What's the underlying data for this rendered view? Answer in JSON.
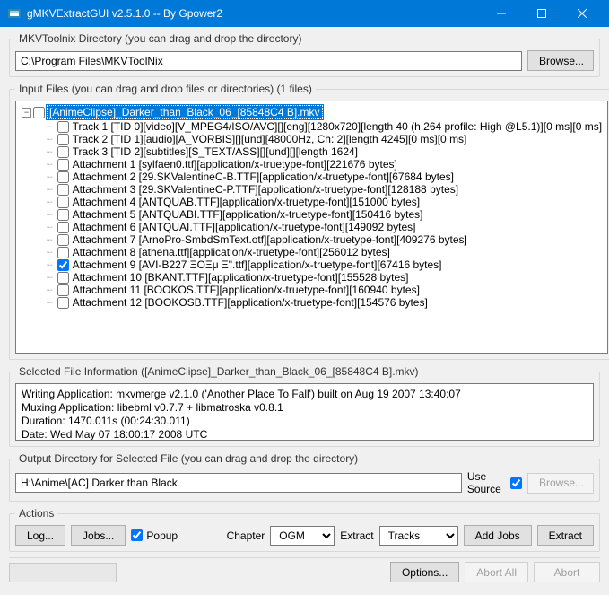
{
  "window": {
    "title": "gMKVExtractGUI v2.5.1.0 -- By Gpower2"
  },
  "dir_section": {
    "legend": "MKVToolnix Directory (you can drag and drop the directory)",
    "path": "C:\\Program Files\\MKVToolNix",
    "browse": "Browse..."
  },
  "input_section": {
    "legend": "Input Files (you can drag and drop files or directories) (1 files)",
    "root": "[AnimeClipse]_Darker_than_Black_06_[85848C4 B].mkv",
    "items": [
      {
        "checked": false,
        "label": "Track 1 [TID 0][video][V_MPEG4/ISO/AVC][][eng][1280x720][length 40 (h.264 profile: High @L5.1)][0 ms][0 ms]"
      },
      {
        "checked": false,
        "label": "Track 2 [TID 1][audio][A_VORBIS][][und][48000Hz, Ch: 2][length 4245][0 ms][0 ms]"
      },
      {
        "checked": false,
        "label": "Track 3 [TID 2][subtitles][S_TEXT/ASS][][und][][length 1624]"
      },
      {
        "checked": false,
        "label": "Attachment 1 [sylfaen0.ttf][application/x-truetype-font][221676 bytes]"
      },
      {
        "checked": false,
        "label": "Attachment 2 [29.SKValentineC-B.TTF][application/x-truetype-font][67684 bytes]"
      },
      {
        "checked": false,
        "label": "Attachment 3 [29.SKValentineC-P.TTF][application/x-truetype-font][128188 bytes]"
      },
      {
        "checked": false,
        "label": "Attachment 4 [ANTQUAB.TTF][application/x-truetype-font][151000 bytes]"
      },
      {
        "checked": false,
        "label": "Attachment 5 [ANTQUABI.TTF][application/x-truetype-font][150416 bytes]"
      },
      {
        "checked": false,
        "label": "Attachment 6 [ANTQUAI.TTF][application/x-truetype-font][149092 bytes]"
      },
      {
        "checked": false,
        "label": "Attachment 7 [ArnoPro-SmbdSmText.otf][application/x-truetype-font][409276 bytes]"
      },
      {
        "checked": false,
        "label": "Attachment 8 [athena.ttf][application/x-truetype-font][256012 bytes]"
      },
      {
        "checked": true,
        "label": "Attachment 9 [AVI-B227 ΞΟΞμ Ξ\".ttf][application/x-truetype-font][67416 bytes]"
      },
      {
        "checked": false,
        "label": "Attachment 10 [BKANT.TTF][application/x-truetype-font][155528 bytes]"
      },
      {
        "checked": false,
        "label": "Attachment 11 [BOOKOS.TTF][application/x-truetype-font][160940 bytes]"
      },
      {
        "checked": false,
        "label": "Attachment 12 [BOOKOSB.TTF][application/x-truetype-font][154576 bytes]"
      }
    ]
  },
  "selected_info": {
    "legend": "Selected File Information ([AnimeClipse]_Darker_than_Black_06_[85848C4 B].mkv)",
    "lines": [
      "Writing Application: mkvmerge v2.1.0 ('Another Place To Fall') built on Aug 19 2007 13:40:07",
      "Muxing Application: libebml v0.7.7 + libmatroska v0.8.1",
      "Duration: 1470.011s (00:24:30.011)",
      "Date: Wed May 07 18:00:17 2008 UTC"
    ]
  },
  "output_section": {
    "legend": "Output Directory for Selected File (you can drag and drop the directory)",
    "path": "H:\\Anime\\[AC] Darker than Black",
    "use_source": "Use Source",
    "browse": "Browse..."
  },
  "actions": {
    "legend": "Actions",
    "log": "Log...",
    "jobs": "Jobs...",
    "popup": "Popup",
    "chapter_lbl": "Chapter",
    "chapter_val": "OGM",
    "extract_lbl": "Extract",
    "extract_val": "Tracks",
    "add_jobs": "Add Jobs",
    "extract_btn": "Extract"
  },
  "bottom": {
    "options": "Options...",
    "abort_all": "Abort All",
    "abort": "Abort"
  }
}
